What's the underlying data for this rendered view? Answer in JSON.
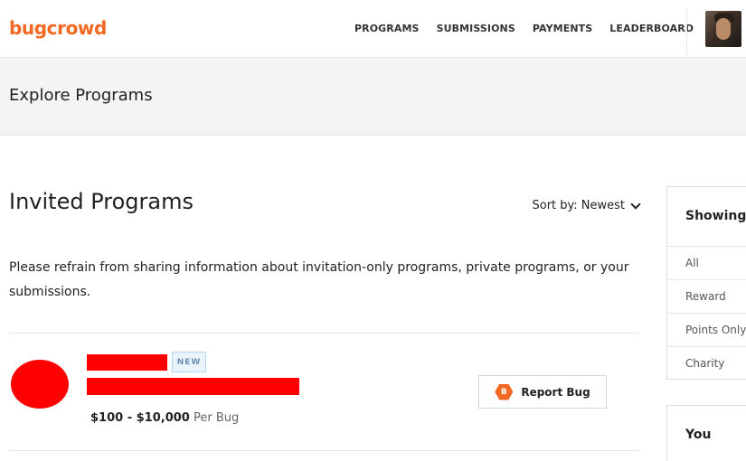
{
  "brand": {
    "name": "bugcrowd",
    "color": "#f26822"
  },
  "nav": {
    "items": [
      "PROGRAMS",
      "SUBMISSIONS",
      "PAYMENTS",
      "LEADERBOARD"
    ]
  },
  "user": {
    "avatar_icon": "user-avatar"
  },
  "band": {
    "title": "Explore Programs"
  },
  "main": {
    "heading": "Invited Programs",
    "sort_label": "Sort by: Newest",
    "notice": "Please refrain from sharing information about invitation-only programs, private programs, or your submissions."
  },
  "program": {
    "badge": "NEW",
    "reward_range": "$100 - $10,000",
    "reward_unit": "Per Bug",
    "report_button": "Report Bug",
    "report_icon_letter": "B",
    "redaction_color": "#ff0000"
  },
  "filter_panel": {
    "title": "Showing",
    "items": [
      "All",
      "Reward",
      "Points Only",
      "Charity"
    ]
  },
  "you_panel": {
    "title": "You"
  }
}
